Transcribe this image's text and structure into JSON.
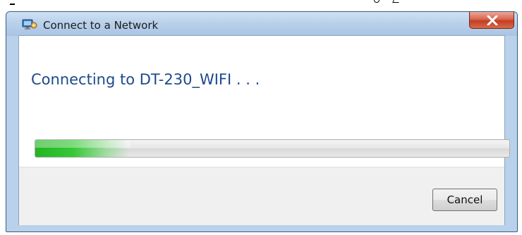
{
  "window": {
    "title": "Connect to a Network",
    "icon": "network-wizard-icon",
    "close_icon": "close-x-icon"
  },
  "main": {
    "status_text": "Connecting to DT-230_WIFI . . .",
    "progress": {
      "type": "indeterminate-marquee",
      "highlight_fraction": 0.2,
      "color": "#2eb82e"
    }
  },
  "footer": {
    "cancel_label": "Cancel"
  }
}
